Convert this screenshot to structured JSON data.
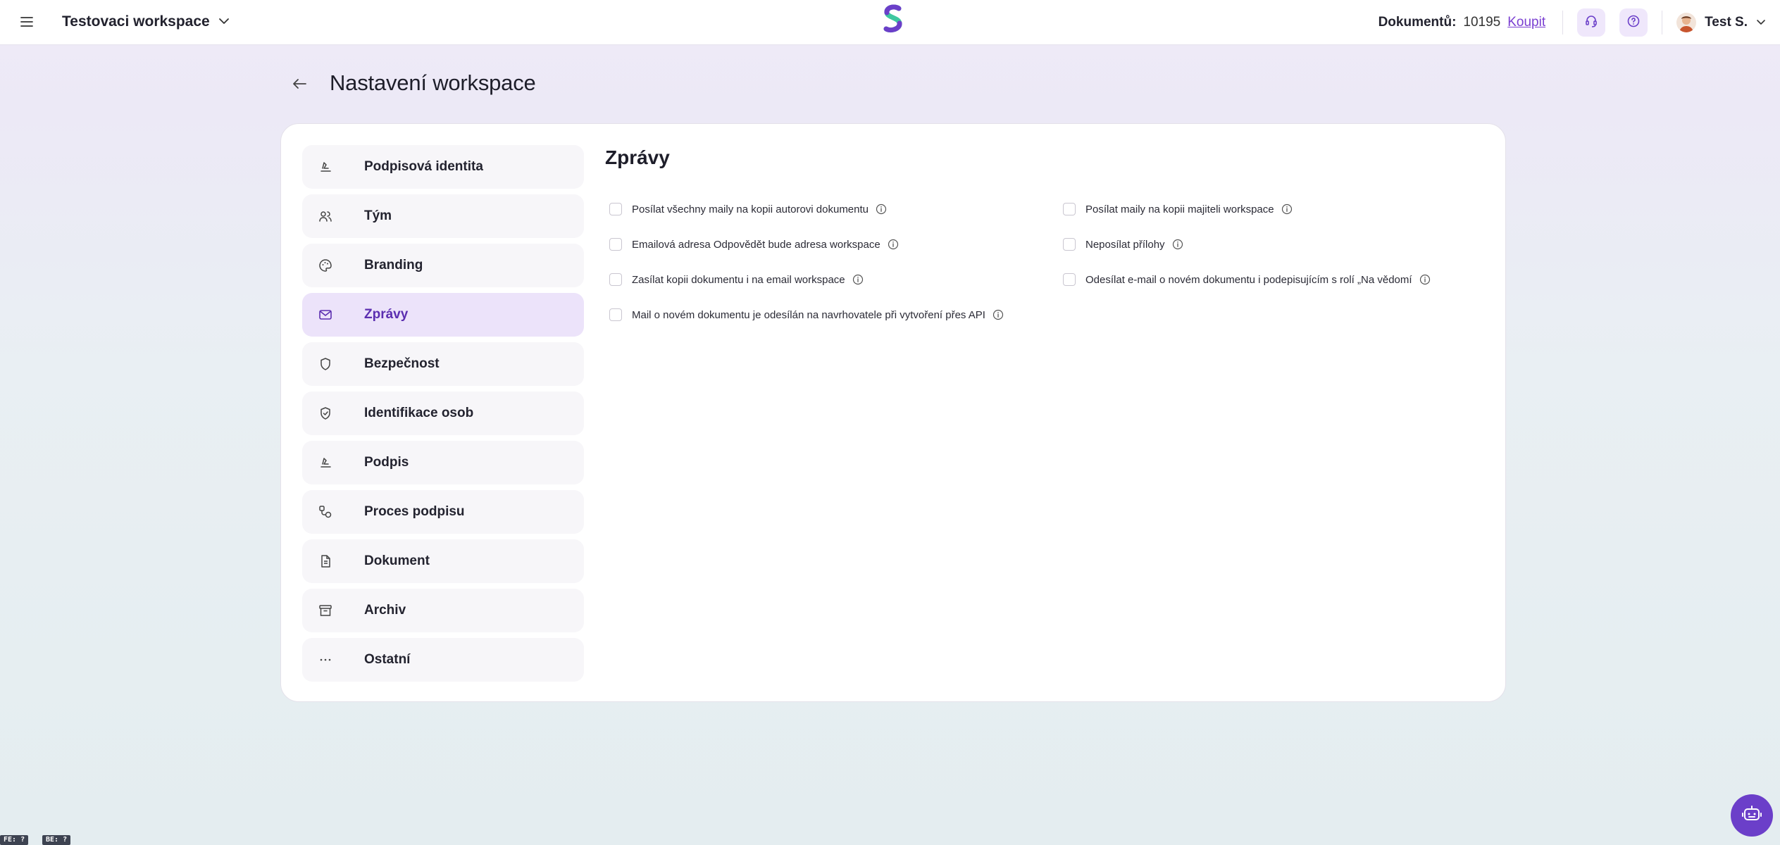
{
  "header": {
    "workspace_name": "Testovaci workspace",
    "documents_label": "Dokumentů:",
    "documents_count": "10195",
    "buy_label": "Koupit",
    "user_name": "Test S."
  },
  "page": {
    "title": "Nastavení workspace"
  },
  "sidebar": {
    "items": [
      {
        "label": "Podpisová identita",
        "icon": "signature-icon"
      },
      {
        "label": "Tým",
        "icon": "users-icon"
      },
      {
        "label": "Branding",
        "icon": "palette-icon"
      },
      {
        "label": "Zprávy",
        "icon": "mail-icon",
        "active": true
      },
      {
        "label": "Bezpečnost",
        "icon": "shield-icon"
      },
      {
        "label": "Identifikace osob",
        "icon": "shield-check-icon"
      },
      {
        "label": "Podpis",
        "icon": "signature-icon"
      },
      {
        "label": "Proces podpisu",
        "icon": "workflow-icon"
      },
      {
        "label": "Dokument",
        "icon": "document-icon"
      },
      {
        "label": "Archiv",
        "icon": "archive-icon"
      },
      {
        "label": "Ostatní",
        "icon": "more-icon"
      }
    ]
  },
  "messages": {
    "title": "Zprávy",
    "options_left": [
      "Posílat všechny maily na kopii autorovi dokumentu",
      "Emailová adresa Odpovědět bude adresa workspace",
      "Zasílat kopii dokumentu i na email workspace",
      "Mail o novém dokumentu je odesílán na navrhovatele při vytvoření přes API"
    ],
    "options_right": [
      "Posílat maily na kopii majiteli workspace",
      "Neposílat přílohy",
      "Odesílat e-mail o novém dokumentu i podepisujícím s rolí „Na vědomí"
    ]
  },
  "footer": {
    "fe_badge": "FE: ?",
    "be_badge": "BE: ?"
  },
  "colors": {
    "accent": "#6b3fc9",
    "active_bg": "#ece3fa",
    "link": "#7a3fd1"
  }
}
